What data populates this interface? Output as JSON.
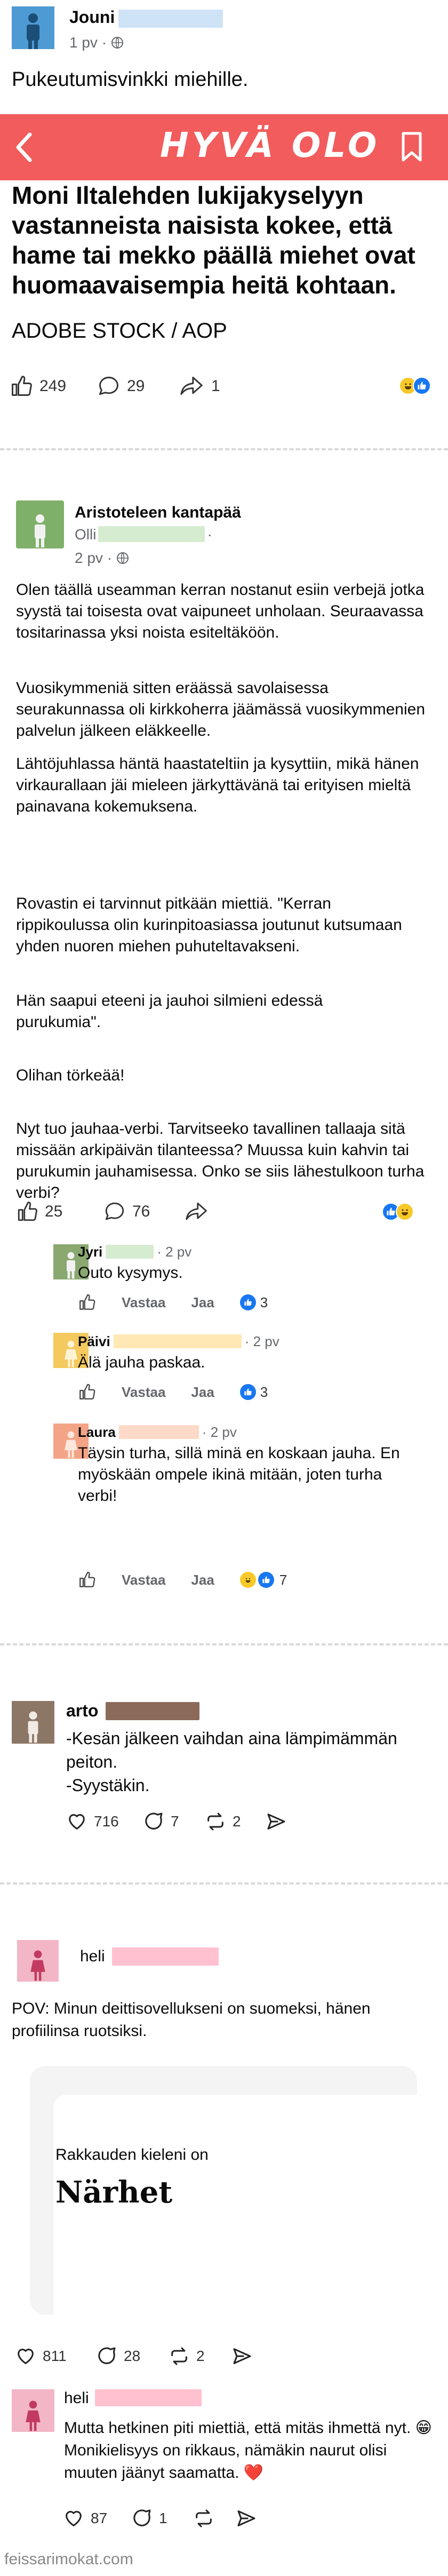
{
  "post1": {
    "author": "Jouni",
    "time": "1 pv ·",
    "text": "Pukeutumisvinkki miehille.",
    "banner_title": "HYVÄ OLO",
    "article_text": "Moni Iltalehden lukijakyselyyn vastanneista naisista kokee, että hame tai mekko päällä miehet ovat huomaavaisempia heitä kohtaan.",
    "credit": "ADOBE STOCK / AOP",
    "likes": "249",
    "comments": "29",
    "shares": "1",
    "banner_color": "#f25c5c"
  },
  "post2": {
    "group": "Aristoteleen kantapää",
    "author": "Olli",
    "author_suffix": "·",
    "time": "2 pv ·",
    "paragraphs": [
      "Olen täällä useamman kerran nostanut esiin verbejä jotka syystä tai toisesta ovat vaipuneet unholaan. Seuraavassa tositarinassa yksi noista esiteltäköön.",
      "Vuosikymmeniä sitten eräässä savolaisessa seurakunnassa oli kirkkoherra jäämässä vuosikymmenien palvelun jälkeen eläkkeelle.",
      "Lähtöjuhlassa häntä haastateltiin ja kysyttiin, mikä hänen virkaurallaan jäi mieleen järkyttävänä tai erityisen mieltä painavana kokemuksena.",
      "Rovastin ei tarvinnut pitkään miettiä. \"Kerran rippikoulussa olin kurinpitoasiassa joutunut kutsumaan yhden nuoren miehen puhuteltavakseni.",
      "Hän saapui eteeni ja jauhoi silmieni edessä purukumia\".",
      "Olihan törkeää!",
      "Nyt tuo jauhaa-verbi. Tarvitseeko tavallinen tallaaja sitä missään arkipäivän tilanteessa? Muussa kuin kahvin tai purukumin jauhamisessa. Onko se siis lähestulkoon turha verbi?"
    ],
    "likes": "25",
    "comments": "76",
    "comments_list": [
      {
        "author": "Jyri",
        "time": "· 2 pv",
        "text": "Outo kysymys.",
        "reply": "Vastaa",
        "like": "Jaa",
        "count": "3"
      },
      {
        "author": "Päivi",
        "time": "· 2 pv",
        "text": "Älä jauha paskaa.",
        "reply": "Vastaa",
        "like": "Jaa",
        "count": "3"
      },
      {
        "author": "Laura",
        "time": "· 2 pv",
        "text": "Täysin turha, sillä minä en koskaan jauha. En myöskään ompele ikinä mitään, joten turha verbi!",
        "reply": "Vastaa",
        "like": "Jaa",
        "count": "7"
      }
    ]
  },
  "post3": {
    "author": "arto",
    "text": "-Kesän jälkeen vaihdan aina lämpimämmän peiton.\n-Syystäkin.",
    "likes": "716",
    "replies": "7",
    "reposts": "2"
  },
  "post4": {
    "author": "heli",
    "text": "POV: Minun deittisovellukseni on suomeksi, hänen profiilinsa ruotsiksi.",
    "card_label": "Rakkauden kieleni on",
    "card_value": "Närhet",
    "likes": "811",
    "replies": "28",
    "reposts": "2"
  },
  "post5": {
    "author": "heli",
    "text": "Mutta hetkinen piti miettiä, että mitäs ihmettä nyt. 😁 Monikielisyys on rikkaus, nämäkin naurut olisi muuten jäänyt saamatta. ❤️",
    "likes": "87",
    "replies": "1"
  },
  "watermark": "feissarimokat.com",
  "colors": {
    "male_avatar": "#5aa7d8",
    "group_avatar": "#7fb069",
    "redact_blue": "#cfe3f7",
    "redact_green": "#d6ecd0",
    "redact_yellow": "#ffe8b3",
    "redact_peach": "#ffd9c7",
    "redact_brown": "#8b6a5a",
    "redact_pink": "#ffc1d0"
  }
}
